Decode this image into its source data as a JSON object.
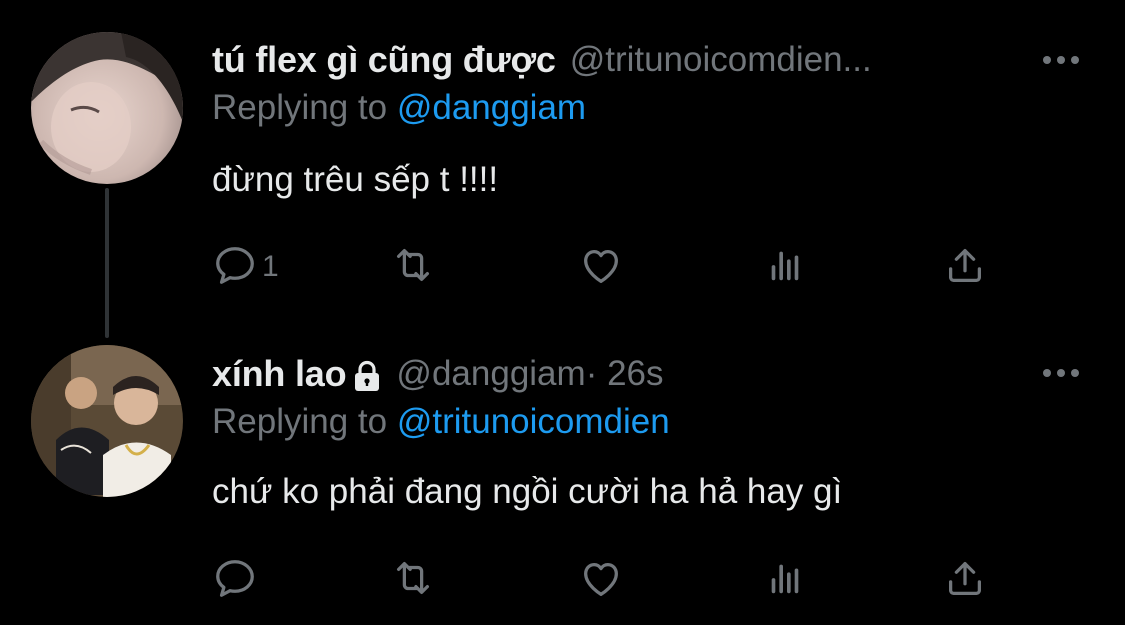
{
  "tweets": [
    {
      "display_name": "tú flex gì cũng được",
      "handle": "@tritunoicomdien...",
      "time": "",
      "locked": false,
      "reply_prefix": "Replying to ",
      "reply_to": "@danggiam",
      "text": "đừng trêu sếp t !!!!",
      "reply_count": "1",
      "retweet_count": "",
      "like_count": ""
    },
    {
      "display_name": "xính lao",
      "handle": "@danggiam",
      "time": " · 26s",
      "locked": true,
      "reply_prefix": "Replying to ",
      "reply_to": "@tritunoicomdien",
      "text": "chứ ko phải đang ngồi cười ha hả hay gì",
      "reply_count": "",
      "retweet_count": "",
      "like_count": ""
    }
  ],
  "icons": {
    "reply": "reply-icon",
    "retweet": "retweet-icon",
    "like": "heart-icon",
    "analytics": "analytics-icon",
    "share": "share-icon",
    "more": "more-icon",
    "lock": "lock-icon"
  },
  "colors": {
    "background": "#000000",
    "primary_text": "#e7e9ea",
    "secondary_text": "#71767b",
    "accent": "#1d9bf0",
    "thread_line": "#2f3336"
  }
}
